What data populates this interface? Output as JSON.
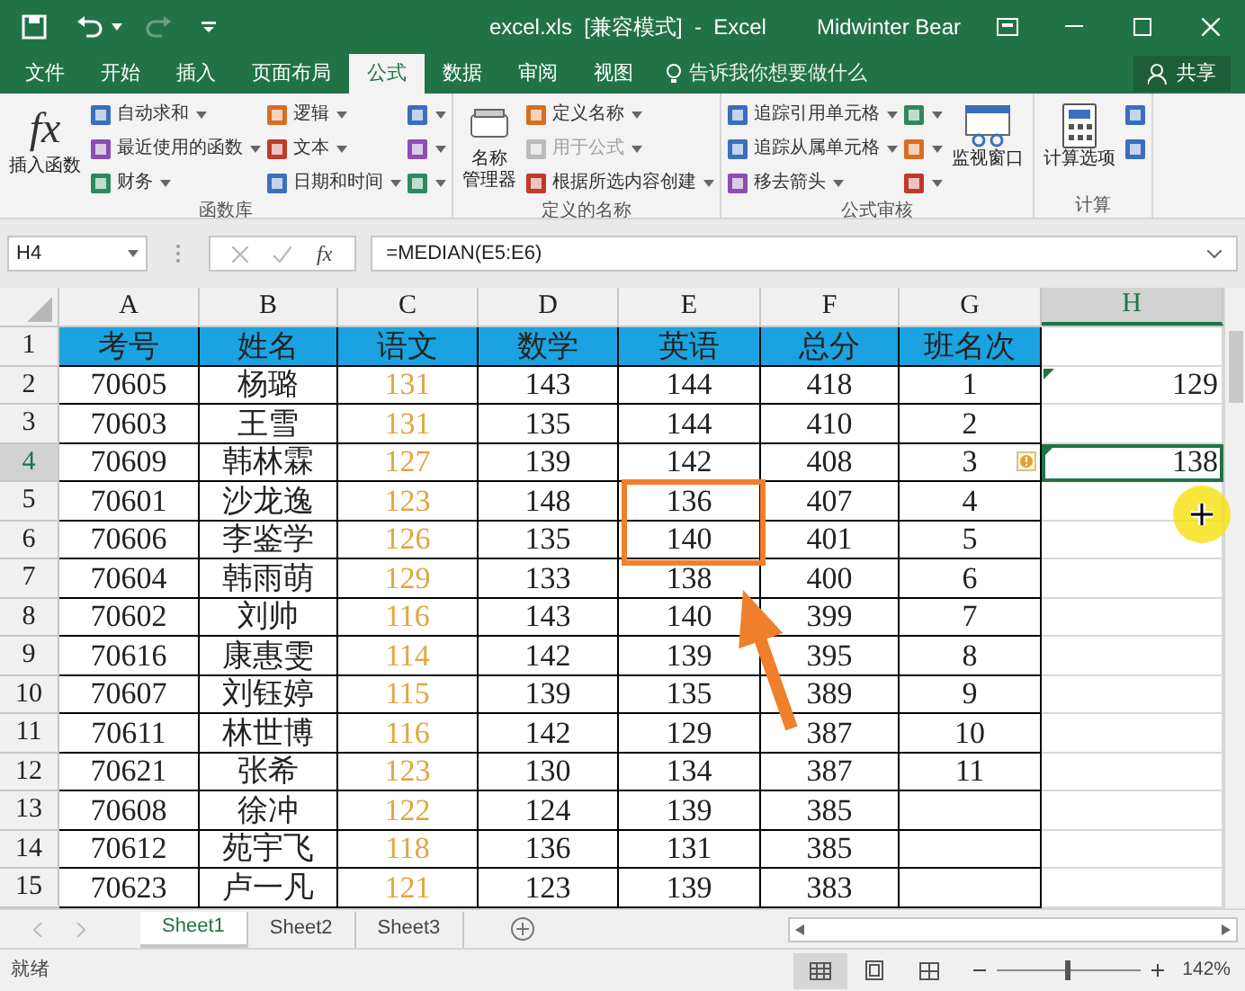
{
  "window": {
    "title": "excel.xls  [兼容模式]  -  Excel",
    "user": "Midwinter Bear"
  },
  "tabs": [
    {
      "label": "文件",
      "selected": false
    },
    {
      "label": "开始",
      "selected": false
    },
    {
      "label": "插入",
      "selected": false
    },
    {
      "label": "页面布局",
      "selected": false
    },
    {
      "label": "公式",
      "selected": true
    },
    {
      "label": "数据",
      "selected": false
    },
    {
      "label": "审阅",
      "selected": false
    },
    {
      "label": "视图",
      "selected": false
    }
  ],
  "tell_me": {
    "placeholder": "告诉我你想要做什么"
  },
  "share_button": "共享",
  "ribbon": [
    {
      "label": "函数库",
      "big": [
        {
          "lines": [
            "插入函数"
          ],
          "glyph": "fx"
        }
      ],
      "columns": [
        [
          {
            "label": "自动求和",
            "disabled": false
          },
          {
            "label": "最近使用的函数",
            "disabled": false
          },
          {
            "label": "财务",
            "disabled": false
          }
        ],
        [
          {
            "label": "逻辑",
            "disabled": false
          },
          {
            "label": "文本",
            "disabled": false
          },
          {
            "label": "日期和时间",
            "disabled": false
          }
        ],
        [
          {
            "disabled": false
          },
          {
            "disabled": false
          },
          {
            "disabled": false
          }
        ]
      ]
    },
    {
      "label": "定义的名称",
      "big": [
        {
          "lines": [
            "名称",
            "管理器"
          ]
        }
      ],
      "columns": [
        [
          {
            "label": "定义名称",
            "disabled": false
          },
          {
            "label": "用于公式",
            "disabled": true
          },
          {
            "label": "根据所选内容创建",
            "disabled": false
          }
        ]
      ]
    },
    {
      "label": "公式审核",
      "columns": [
        [
          {
            "label": "追踪引用单元格",
            "disabled": false
          },
          {
            "label": "追踪从属单元格",
            "disabled": false
          },
          {
            "label": "移去箭头",
            "disabled": false
          }
        ],
        [
          {
            "disabled": false
          },
          {
            "disabled": false
          },
          {
            "disabled": false
          }
        ]
      ],
      "big_after": [
        {
          "lines": [
            "监视窗口"
          ]
        }
      ]
    },
    {
      "label": "计算",
      "big": [
        {
          "lines": [
            "计算选项"
          ]
        }
      ],
      "columns": [
        [
          {
            "disabled": false
          },
          {
            "disabled": false
          }
        ]
      ]
    }
  ],
  "name_box": "H4",
  "function_button": "fx",
  "formula": "=MEDIAN(E5:E6)",
  "columns": [
    {
      "label": "A",
      "selected": false
    },
    {
      "label": "B",
      "selected": false
    },
    {
      "label": "C",
      "selected": false,
      "color": "#e0a640"
    },
    {
      "label": "D",
      "selected": false
    },
    {
      "label": "E",
      "selected": false
    },
    {
      "label": "F",
      "selected": false
    },
    {
      "label": "G",
      "selected": false
    },
    {
      "label": "H",
      "selected": true
    }
  ],
  "rows": [
    {
      "number": "1",
      "selected": false,
      "kind": "header",
      "cells": [
        "考号",
        "姓名",
        "语文",
        "数学",
        "英语",
        "总分",
        "班名次"
      ]
    },
    {
      "number": "2",
      "selected": false,
      "kind": "data",
      "cells": [
        "70605",
        "杨璐",
        "131",
        "143",
        "144",
        "418",
        "1"
      ],
      "h": "129",
      "h_marker": true
    },
    {
      "number": "3",
      "selected": false,
      "kind": "data",
      "cells": [
        "70603",
        "王雪",
        "131",
        "135",
        "144",
        "410",
        "2"
      ]
    },
    {
      "number": "4",
      "selected": true,
      "kind": "data",
      "cells": [
        "70609",
        "韩林霖",
        "127",
        "139",
        "142",
        "408",
        "3"
      ],
      "h": "138",
      "h_marker": true,
      "alert": true
    },
    {
      "number": "5",
      "selected": false,
      "kind": "data",
      "cells": [
        "70601",
        "沙龙逸",
        "123",
        "148",
        "136",
        "407",
        "4"
      ]
    },
    {
      "number": "6",
      "selected": false,
      "kind": "data",
      "cells": [
        "70606",
        "李鉴学",
        "126",
        "135",
        "140",
        "401",
        "5"
      ]
    },
    {
      "number": "7",
      "selected": false,
      "kind": "data",
      "cells": [
        "70604",
        "韩雨萌",
        "129",
        "133",
        "138",
        "400",
        "6"
      ]
    },
    {
      "number": "8",
      "selected": false,
      "kind": "data",
      "cells": [
        "70602",
        "刘帅",
        "116",
        "143",
        "140",
        "399",
        "7"
      ]
    },
    {
      "number": "9",
      "selected": false,
      "kind": "data",
      "cells": [
        "70616",
        "康惠雯",
        "114",
        "142",
        "139",
        "395",
        "8"
      ]
    },
    {
      "number": "10",
      "selected": false,
      "kind": "data",
      "cells": [
        "70607",
        "刘钰婷",
        "115",
        "139",
        "135",
        "389",
        "9"
      ]
    },
    {
      "number": "11",
      "selected": false,
      "kind": "data",
      "cells": [
        "70611",
        "林世博",
        "116",
        "142",
        "129",
        "387",
        "10"
      ]
    },
    {
      "number": "12",
      "selected": false,
      "kind": "data",
      "cells": [
        "70621",
        "张希",
        "123",
        "130",
        "134",
        "387",
        "11"
      ]
    },
    {
      "number": "13",
      "selected": false,
      "kind": "data",
      "cells": [
        "70608",
        "徐冲",
        "122",
        "124",
        "139",
        "385"
      ]
    },
    {
      "number": "14",
      "selected": false,
      "kind": "data",
      "cells": [
        "70612",
        "苑宇飞",
        "118",
        "136",
        "131",
        "385"
      ]
    },
    {
      "number": "15",
      "selected": false,
      "kind": "data",
      "cells": [
        "70623",
        "卢一凡",
        "121",
        "123",
        "139",
        "383"
      ]
    }
  ],
  "sheets": [
    {
      "label": "Sheet1",
      "selected": true
    },
    {
      "label": "Sheet2",
      "selected": false
    },
    {
      "label": "Sheet3",
      "selected": false
    }
  ],
  "status": "就绪",
  "zoom": {
    "level": 0.48,
    "reading": "142%"
  }
}
